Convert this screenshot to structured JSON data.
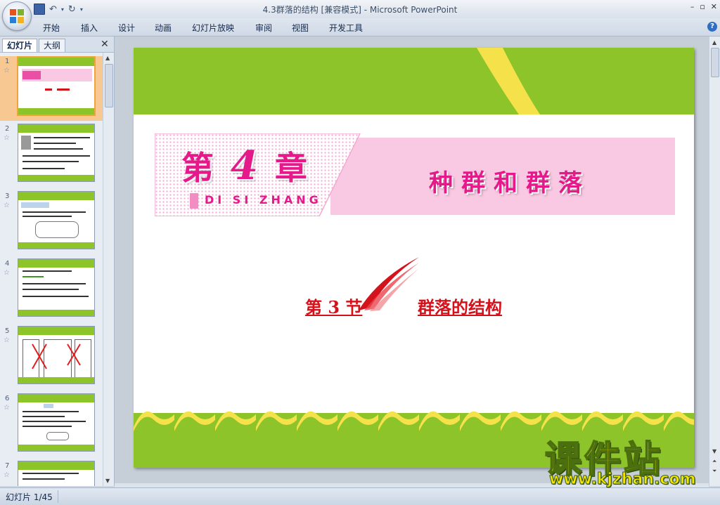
{
  "window": {
    "title": "4.3群落的结构 [兼容模式] - Microsoft PowerPoint",
    "controls": [
      "–",
      "▫",
      "✕"
    ]
  },
  "ribbon_tabs": [
    "开始",
    "插入",
    "设计",
    "动画",
    "幻灯片放映",
    "审阅",
    "视图",
    "开发工具"
  ],
  "pane_tabs": {
    "slides": "幻灯片",
    "outline": "大纲"
  },
  "thumbnails": [
    {
      "num": "1",
      "active": true
    },
    {
      "num": "2",
      "active": false
    },
    {
      "num": "3",
      "active": false
    },
    {
      "num": "4",
      "active": false
    },
    {
      "num": "5",
      "active": false
    },
    {
      "num": "6",
      "active": false
    },
    {
      "num": "7",
      "active": false
    }
  ],
  "slide": {
    "chapter_prefix": "第",
    "chapter_number": "4",
    "chapter_suffix": "章",
    "chapter_pinyin": "DI SI ZHANG",
    "unit_title": "种群和群落",
    "section_number": "第 3 节",
    "section_name": "群落的结构"
  },
  "status": {
    "slide_counter": "幻灯片 1/45"
  },
  "watermark": {
    "cn": "课件站",
    "url": "www.kjzhan.com"
  },
  "colors": {
    "slide_green": "#8cc42a",
    "wave_yellow": "#f5e24a",
    "title_pink": "#e6198a",
    "section_red": "#d4121c",
    "banner_pink": "#f9c9e3"
  }
}
